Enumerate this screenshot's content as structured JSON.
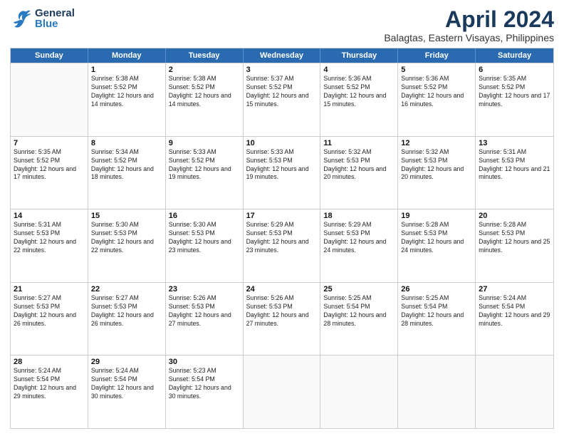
{
  "header": {
    "logo_general": "General",
    "logo_blue": "Blue",
    "title": "April 2024",
    "subtitle": "Balagtas, Eastern Visayas, Philippines"
  },
  "calendar": {
    "days": [
      "Sunday",
      "Monday",
      "Tuesday",
      "Wednesday",
      "Thursday",
      "Friday",
      "Saturday"
    ],
    "rows": [
      [
        {
          "day": "",
          "empty": true
        },
        {
          "day": "1",
          "sunrise": "5:38 AM",
          "sunset": "5:52 PM",
          "daylight": "12 hours and 14 minutes."
        },
        {
          "day": "2",
          "sunrise": "5:38 AM",
          "sunset": "5:52 PM",
          "daylight": "12 hours and 14 minutes."
        },
        {
          "day": "3",
          "sunrise": "5:37 AM",
          "sunset": "5:52 PM",
          "daylight": "12 hours and 15 minutes."
        },
        {
          "day": "4",
          "sunrise": "5:36 AM",
          "sunset": "5:52 PM",
          "daylight": "12 hours and 15 minutes."
        },
        {
          "day": "5",
          "sunrise": "5:36 AM",
          "sunset": "5:52 PM",
          "daylight": "12 hours and 16 minutes."
        },
        {
          "day": "6",
          "sunrise": "5:35 AM",
          "sunset": "5:52 PM",
          "daylight": "12 hours and 17 minutes."
        }
      ],
      [
        {
          "day": "7",
          "sunrise": "5:35 AM",
          "sunset": "5:52 PM",
          "daylight": "12 hours and 17 minutes."
        },
        {
          "day": "8",
          "sunrise": "5:34 AM",
          "sunset": "5:52 PM",
          "daylight": "12 hours and 18 minutes."
        },
        {
          "day": "9",
          "sunrise": "5:33 AM",
          "sunset": "5:52 PM",
          "daylight": "12 hours and 19 minutes."
        },
        {
          "day": "10",
          "sunrise": "5:33 AM",
          "sunset": "5:53 PM",
          "daylight": "12 hours and 19 minutes."
        },
        {
          "day": "11",
          "sunrise": "5:32 AM",
          "sunset": "5:53 PM",
          "daylight": "12 hours and 20 minutes."
        },
        {
          "day": "12",
          "sunrise": "5:32 AM",
          "sunset": "5:53 PM",
          "daylight": "12 hours and 20 minutes."
        },
        {
          "day": "13",
          "sunrise": "5:31 AM",
          "sunset": "5:53 PM",
          "daylight": "12 hours and 21 minutes."
        }
      ],
      [
        {
          "day": "14",
          "sunrise": "5:31 AM",
          "sunset": "5:53 PM",
          "daylight": "12 hours and 22 minutes."
        },
        {
          "day": "15",
          "sunrise": "5:30 AM",
          "sunset": "5:53 PM",
          "daylight": "12 hours and 22 minutes."
        },
        {
          "day": "16",
          "sunrise": "5:30 AM",
          "sunset": "5:53 PM",
          "daylight": "12 hours and 23 minutes."
        },
        {
          "day": "17",
          "sunrise": "5:29 AM",
          "sunset": "5:53 PM",
          "daylight": "12 hours and 23 minutes."
        },
        {
          "day": "18",
          "sunrise": "5:29 AM",
          "sunset": "5:53 PM",
          "daylight": "12 hours and 24 minutes."
        },
        {
          "day": "19",
          "sunrise": "5:28 AM",
          "sunset": "5:53 PM",
          "daylight": "12 hours and 24 minutes."
        },
        {
          "day": "20",
          "sunrise": "5:28 AM",
          "sunset": "5:53 PM",
          "daylight": "12 hours and 25 minutes."
        }
      ],
      [
        {
          "day": "21",
          "sunrise": "5:27 AM",
          "sunset": "5:53 PM",
          "daylight": "12 hours and 26 minutes."
        },
        {
          "day": "22",
          "sunrise": "5:27 AM",
          "sunset": "5:53 PM",
          "daylight": "12 hours and 26 minutes."
        },
        {
          "day": "23",
          "sunrise": "5:26 AM",
          "sunset": "5:53 PM",
          "daylight": "12 hours and 27 minutes."
        },
        {
          "day": "24",
          "sunrise": "5:26 AM",
          "sunset": "5:53 PM",
          "daylight": "12 hours and 27 minutes."
        },
        {
          "day": "25",
          "sunrise": "5:25 AM",
          "sunset": "5:54 PM",
          "daylight": "12 hours and 28 minutes."
        },
        {
          "day": "26",
          "sunrise": "5:25 AM",
          "sunset": "5:54 PM",
          "daylight": "12 hours and 28 minutes."
        },
        {
          "day": "27",
          "sunrise": "5:24 AM",
          "sunset": "5:54 PM",
          "daylight": "12 hours and 29 minutes."
        }
      ],
      [
        {
          "day": "28",
          "sunrise": "5:24 AM",
          "sunset": "5:54 PM",
          "daylight": "12 hours and 29 minutes."
        },
        {
          "day": "29",
          "sunrise": "5:24 AM",
          "sunset": "5:54 PM",
          "daylight": "12 hours and 30 minutes."
        },
        {
          "day": "30",
          "sunrise": "5:23 AM",
          "sunset": "5:54 PM",
          "daylight": "12 hours and 30 minutes."
        },
        {
          "day": "",
          "empty": true
        },
        {
          "day": "",
          "empty": true
        },
        {
          "day": "",
          "empty": true
        },
        {
          "day": "",
          "empty": true
        }
      ]
    ]
  }
}
